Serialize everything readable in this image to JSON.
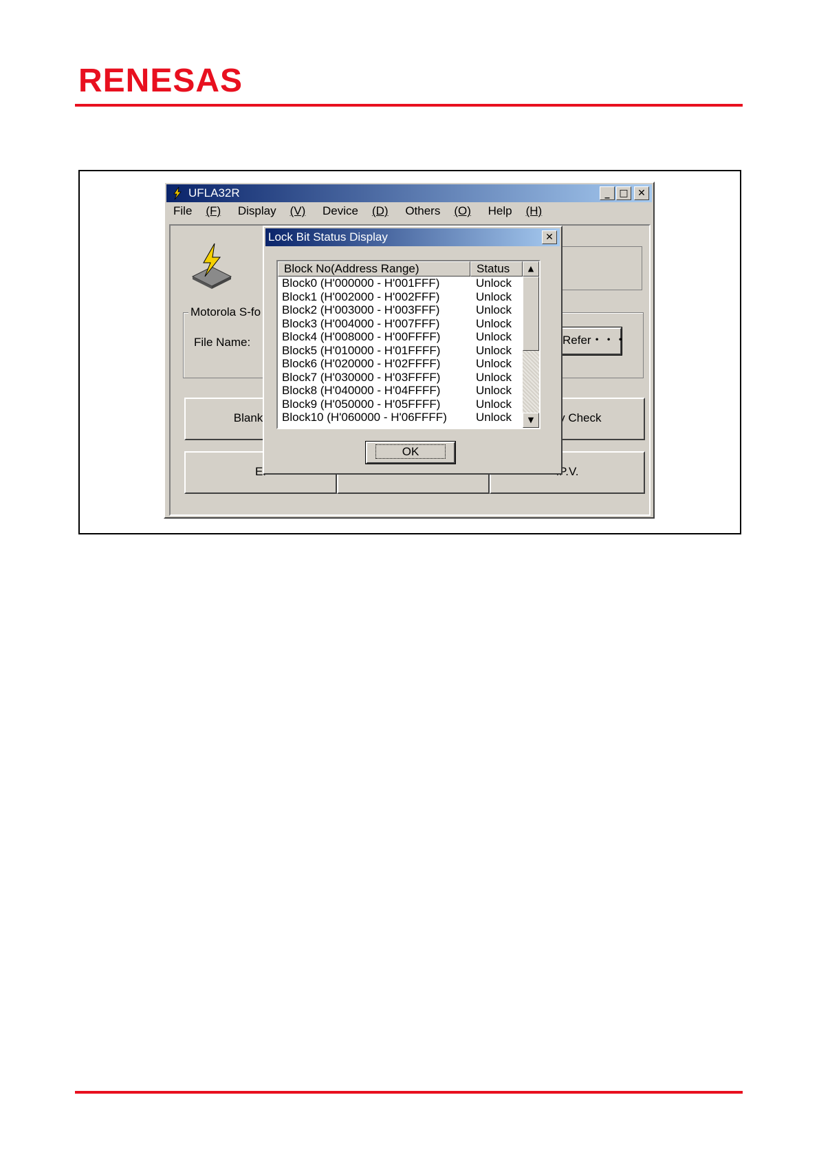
{
  "brand": {
    "logo_text": "RENESAS",
    "accent": "#e8101f"
  },
  "window": {
    "title": "UFLA32R",
    "menu": [
      {
        "label": "File",
        "accel": "(F)"
      },
      {
        "label": "Display",
        "accel": "(V)"
      },
      {
        "label": "Device",
        "accel": "(D)"
      },
      {
        "label": "Others",
        "accel": "(O)"
      },
      {
        "label": "Help",
        "accel": "(H)"
      }
    ],
    "group_label": "Motorola S-fo",
    "file_name_label": "File Name:",
    "refer_button": "Refer・・・",
    "blank_check_button": "Blank Che",
    "verify_check_button": "erify Check",
    "e_button": "E.",
    "pv_button": ".P.V.",
    "controls": {
      "minimize": "_",
      "maximize": "□",
      "close": "✕"
    }
  },
  "dialog": {
    "title": "Lock Bit Status Display",
    "close": "✕",
    "columns": [
      "Block No(Address Range)",
      "Status"
    ],
    "rows": [
      {
        "block": "Block0  (H'000000 - H'001FFF)",
        "status": "Unlock"
      },
      {
        "block": "Block1  (H'002000 - H'002FFF)",
        "status": "Unlock"
      },
      {
        "block": "Block2  (H'003000 - H'003FFF)",
        "status": "Unlock"
      },
      {
        "block": "Block3  (H'004000 - H'007FFF)",
        "status": "Unlock"
      },
      {
        "block": "Block4  (H'008000 - H'00FFFF)",
        "status": "Unlock"
      },
      {
        "block": "Block5  (H'010000 - H'01FFFF)",
        "status": "Unlock"
      },
      {
        "block": "Block6  (H'020000 - H'02FFFF)",
        "status": "Unlock"
      },
      {
        "block": "Block7  (H'030000 - H'03FFFF)",
        "status": "Unlock"
      },
      {
        "block": "Block8  (H'040000 - H'04FFFF)",
        "status": "Unlock"
      },
      {
        "block": "Block9  (H'050000 - H'05FFFF)",
        "status": "Unlock"
      },
      {
        "block": "Block10 (H'060000 - H'06FFFF)",
        "status": "Unlock"
      }
    ],
    "ok_button": "OK",
    "scroll_up": "▲",
    "scroll_down": "▼"
  }
}
